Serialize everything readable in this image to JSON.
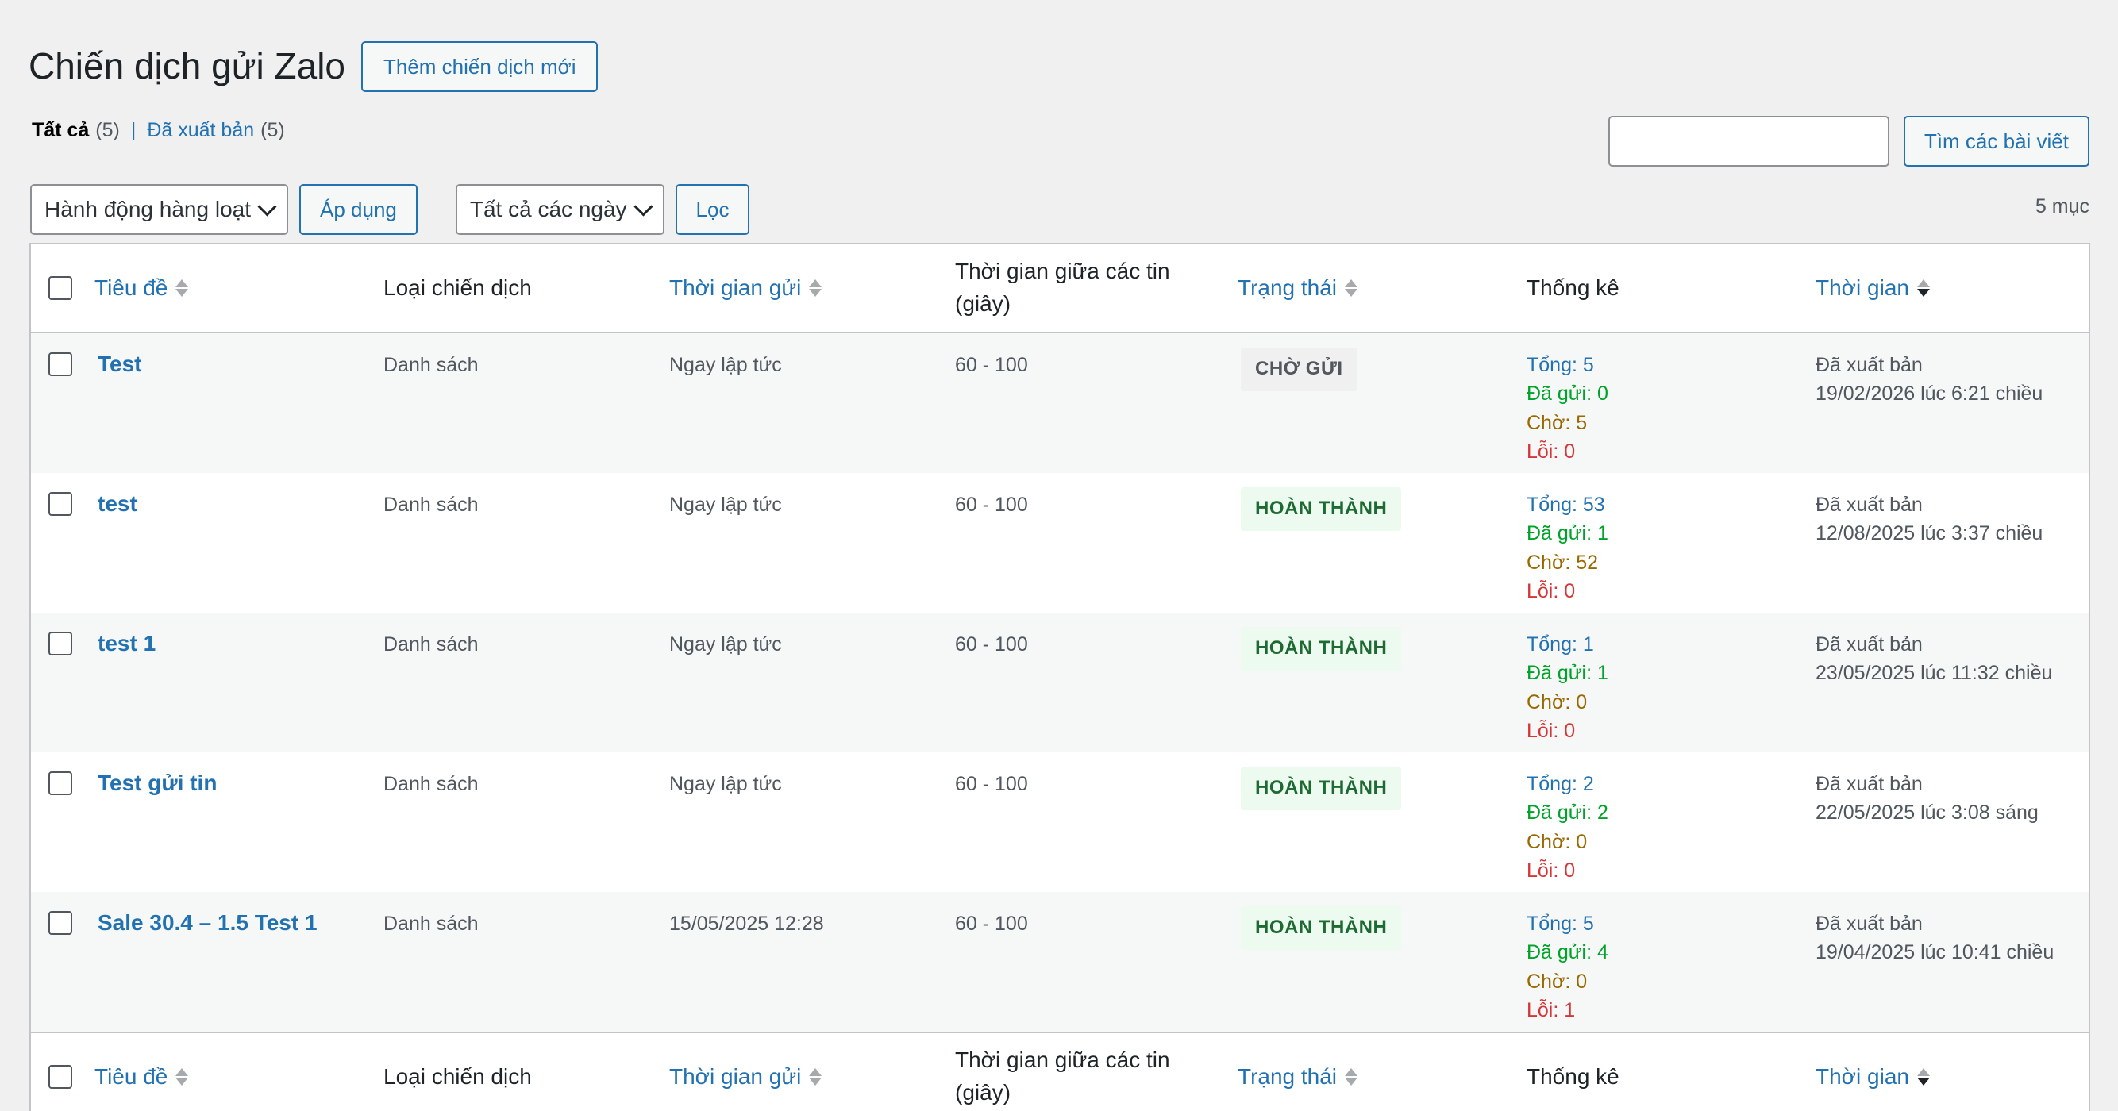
{
  "header": {
    "title": "Chiến dịch gửi Zalo",
    "add_new_label": "Thêm chiến dịch mới"
  },
  "views": {
    "all_label": "Tất cả",
    "all_count": "(5)",
    "published_label": "Đã xuất bản",
    "published_count": "(5)",
    "separator": "|"
  },
  "search": {
    "value": "",
    "button_label": "Tìm các bài viết"
  },
  "tablenav": {
    "bulk_action_selected": "Hành động hàng loạt",
    "apply_label": "Áp dụng",
    "date_filter_selected": "Tất cả các ngày",
    "filter_label": "Lọc",
    "items_count": "5 mục"
  },
  "columns": {
    "title": "Tiêu đề",
    "type": "Loại chiến dịch",
    "send_time": "Thời gian gửi",
    "interval": "Thời gian giữa các tin (giây)",
    "status": "Trạng thái",
    "stats": "Thống kê",
    "date": "Thời gian"
  },
  "rows": [
    {
      "title": "Test",
      "type": "Danh sách",
      "send_time": "Ngay lập tức",
      "interval": "60 - 100",
      "status": "CHỜ GỬI",
      "total": "Tổng: 5",
      "sent": "Đã gửi: 0",
      "waiting": "Chờ: 5",
      "errors": "Lỗi: 0",
      "published": "Đã xuất bản",
      "datetime": "19/02/2026 lúc 6:21 chiều"
    },
    {
      "title": "test",
      "type": "Danh sách",
      "send_time": "Ngay lập tức",
      "interval": "60 - 100",
      "status": "HOÀN THÀNH",
      "total": "Tổng: 53",
      "sent": "Đã gửi: 1",
      "waiting": "Chờ: 52",
      "errors": "Lỗi: 0",
      "published": "Đã xuất bản",
      "datetime": "12/08/2025 lúc 3:37 chiều"
    },
    {
      "title": "test 1",
      "type": "Danh sách",
      "send_time": "Ngay lập tức",
      "interval": "60 - 100",
      "status": "HOÀN THÀNH",
      "total": "Tổng: 1",
      "sent": "Đã gửi: 1",
      "waiting": "Chờ: 0",
      "errors": "Lỗi: 0",
      "published": "Đã xuất bản",
      "datetime": "23/05/2025 lúc 11:32 chiều"
    },
    {
      "title": "Test gửi tin",
      "type": "Danh sách",
      "send_time": "Ngay lập tức",
      "interval": "60 - 100",
      "status": "HOÀN THÀNH",
      "total": "Tổng: 2",
      "sent": "Đã gửi: 2",
      "waiting": "Chờ: 0",
      "errors": "Lỗi: 0",
      "published": "Đã xuất bản",
      "datetime": "22/05/2025 lúc 3:08 sáng"
    },
    {
      "title": "Sale 30.4 – 1.5 Test 1",
      "type": "Danh sách",
      "send_time": "15/05/2025 12:28",
      "interval": "60 - 100",
      "status": "HOÀN THÀNH",
      "total": "Tổng: 5",
      "sent": "Đã gửi: 4",
      "waiting": "Chờ: 0",
      "errors": "Lỗi: 1",
      "published": "Đã xuất bản",
      "datetime": "19/04/2025 lúc 10:41 chiều"
    }
  ],
  "colors": {
    "link": "#2271b1",
    "sent": "#00a32a",
    "waiting": "#996800",
    "error": "#d63638",
    "badge_done_bg": "#edfaef",
    "badge_done_text": "#1d6b32",
    "badge_wait_bg": "#f0f0f1"
  }
}
